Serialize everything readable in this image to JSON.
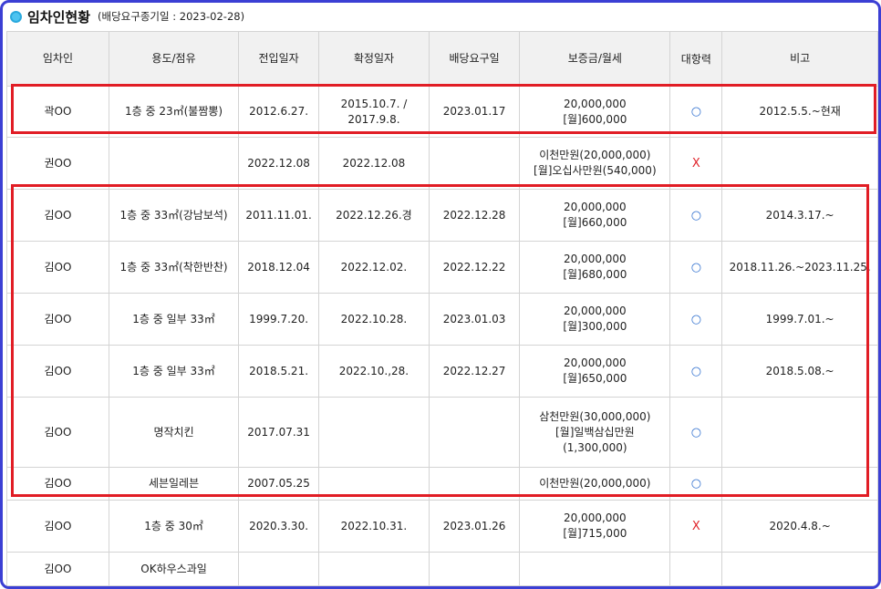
{
  "header": {
    "title": "임차인현황",
    "subtitle": "(배당요구종기일 : 2023-02-28)"
  },
  "columns": [
    "임차인",
    "용도/점유",
    "전입일자",
    "확정일자",
    "배당요구일",
    "보증금/월세",
    "대항력",
    "비고"
  ],
  "rows": [
    {
      "name": "곽OO",
      "use": "1층 중 23㎡(불짬뽕)",
      "move_in": "2012.6.27.",
      "fixed": [
        "2015.10.7. /",
        "2017.9.8."
      ],
      "claim": "2023.01.17",
      "deposit": [
        "20,000,000",
        "[월]600,000"
      ],
      "opp": "○",
      "note": "2012.5.5.~현재"
    },
    {
      "name": "권OO",
      "use": "",
      "move_in": "2022.12.08",
      "fixed": [
        "2022.12.08"
      ],
      "claim": "",
      "deposit": [
        "이천만원(20,000,000)",
        "[월]오십사만원(540,000)"
      ],
      "opp": "X",
      "note": ""
    },
    {
      "name": "김OO",
      "use": "1층 중 33㎡(강남보석)",
      "move_in": "2011.11.01.",
      "fixed": [
        "2022.12.26.경"
      ],
      "claim": "2022.12.28",
      "deposit": [
        "20,000,000",
        "[월]660,000"
      ],
      "opp": "○",
      "note": "2014.3.17.~"
    },
    {
      "name": "김OO",
      "use": "1층 중 33㎡(착한반찬)",
      "move_in": "2018.12.04",
      "fixed": [
        "2022.12.02."
      ],
      "claim": "2022.12.22",
      "deposit": [
        "20,000,000",
        "[월]680,000"
      ],
      "opp": "○",
      "note": "2018.11.26.~2023.11.25."
    },
    {
      "name": "김OO",
      "use": "1층 중 일부 33㎡",
      "move_in": "1999.7.20.",
      "fixed": [
        "2022.10.28."
      ],
      "claim": "2023.01.03",
      "deposit": [
        "20,000,000",
        "[월]300,000"
      ],
      "opp": "○",
      "note": "1999.7.01.~"
    },
    {
      "name": "김OO",
      "use": "1층 중 일부 33㎡",
      "move_in": "2018.5.21.",
      "fixed": [
        "2022.10.,28."
      ],
      "claim": "2022.12.27",
      "deposit": [
        "20,000,000",
        "[월]650,000"
      ],
      "opp": "○",
      "note": "2018.5.08.~"
    },
    {
      "name": "김OO",
      "use": "명작치킨",
      "move_in": "2017.07.31",
      "fixed": [
        ""
      ],
      "claim": "",
      "deposit": [
        "삼천만원(30,000,000)",
        "[월]일백삼십만원",
        "(1,300,000)"
      ],
      "opp": "○",
      "note": ""
    },
    {
      "name": "김OO",
      "use": "세븐일레븐",
      "move_in": "2007.05.25",
      "fixed": [
        ""
      ],
      "claim": "",
      "deposit": [
        "이천만원(20,000,000)"
      ],
      "opp": "○",
      "note": ""
    },
    {
      "name": "김OO",
      "use": "1층 중 30㎡",
      "move_in": "2020.3.30.",
      "fixed": [
        "2022.10.31."
      ],
      "claim": "2023.01.26",
      "deposit": [
        "20,000,000",
        "[월]715,000"
      ],
      "opp": "X",
      "note": "2020.4.8.~"
    },
    {
      "name": "김OO",
      "use": "OK하우스과일",
      "move_in": "",
      "fixed": [
        ""
      ],
      "claim": "",
      "deposit": [
        ""
      ],
      "opp": "",
      "note": ""
    }
  ],
  "colors": {
    "frame": "#3b3fd4",
    "highlight": "#e11d25",
    "circle": "#2f6fcf",
    "cross": "#e0242b"
  }
}
